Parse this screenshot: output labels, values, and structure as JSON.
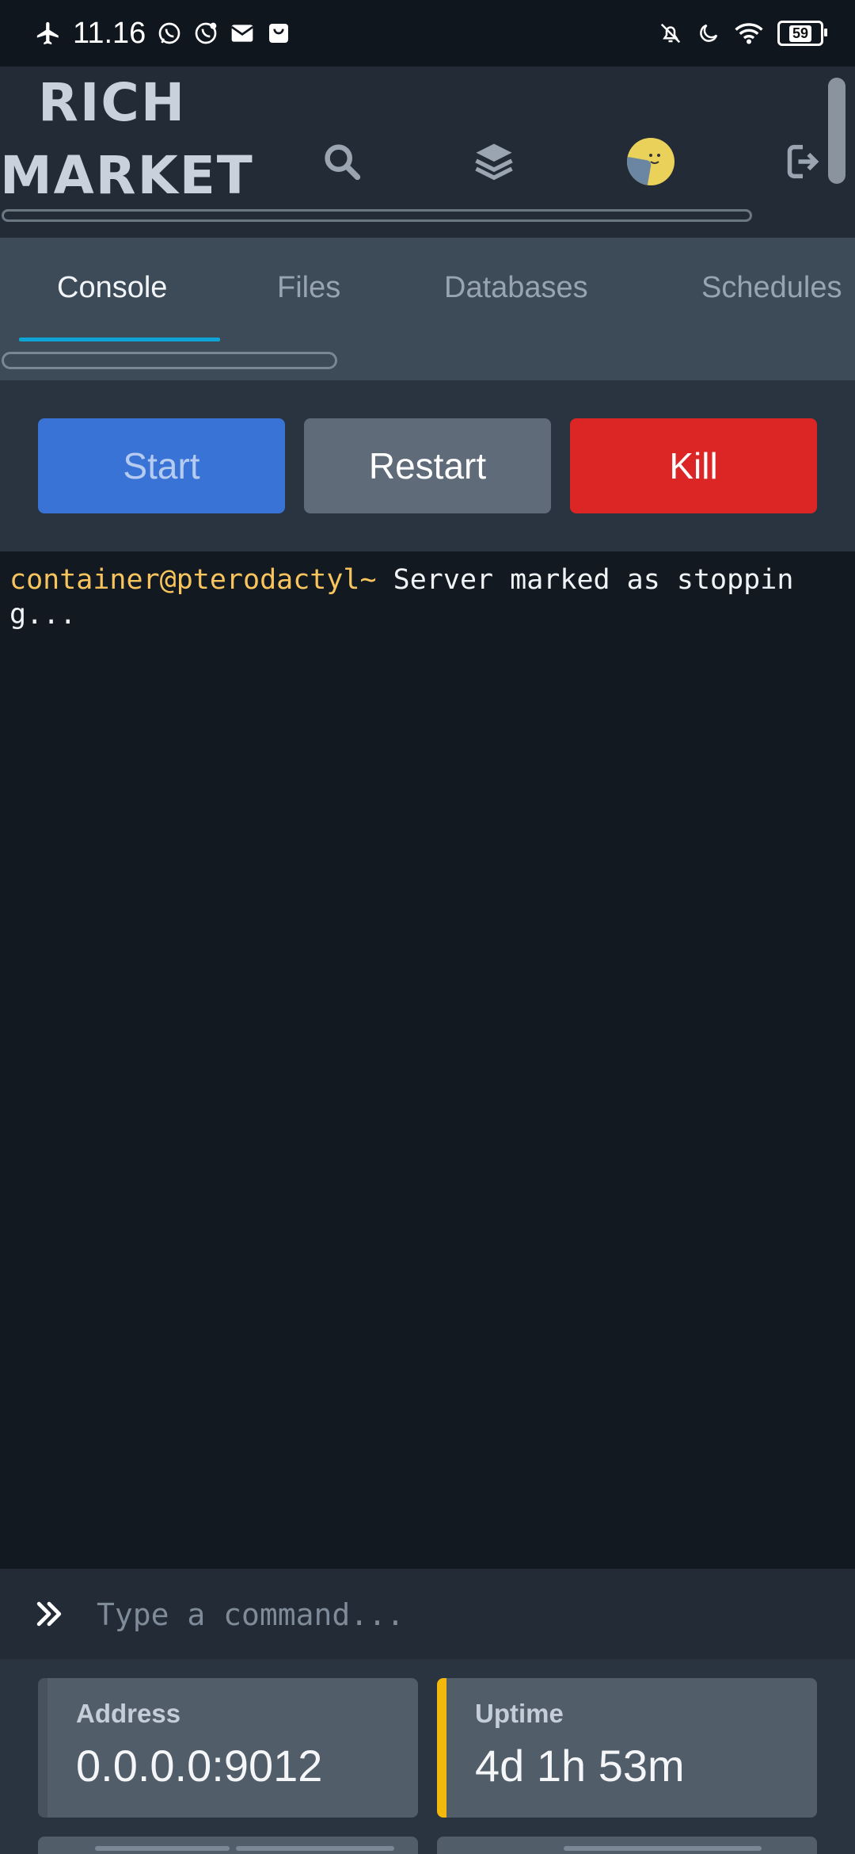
{
  "status_bar": {
    "time": "11.16",
    "battery": "59",
    "left_icons": [
      "airplane-icon",
      "whatsapp-icon",
      "whatsapp-business-icon",
      "mail-icon",
      "shopping-bag-icon"
    ],
    "right_icons": [
      "bell-off-icon",
      "moon-icon",
      "wifi-icon",
      "battery-icon"
    ]
  },
  "header": {
    "brand_line1": "RICH",
    "brand_line2": "MARKET",
    "icons": [
      "search-icon",
      "layers-icon",
      "avatar",
      "logout-icon"
    ]
  },
  "tabs": [
    {
      "label": "Console",
      "active": true
    },
    {
      "label": "Files",
      "active": false
    },
    {
      "label": "Databases",
      "active": false
    },
    {
      "label": "Schedules",
      "active": false
    }
  ],
  "controls": {
    "start_label": "Start",
    "restart_label": "Restart",
    "kill_label": "Kill"
  },
  "console": {
    "prompt": "container@pterodactyl~",
    "message": " Server marked as stopping..."
  },
  "command": {
    "placeholder": "Type a command..."
  },
  "stats": {
    "address_label": "Address",
    "address_value": "0.0.0.0:9012",
    "uptime_label": "Uptime",
    "uptime_value": "4d 1h 53m"
  },
  "colors": {
    "accent_tab": "#0ea5d6",
    "start": "#3a73d6",
    "restart": "#5f6b78",
    "kill": "#dc2626",
    "prompt": "#f8c45e",
    "uptime_accent": "#f2b90c"
  }
}
